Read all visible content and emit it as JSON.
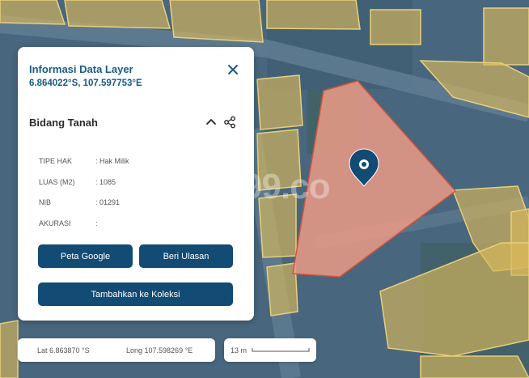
{
  "panel": {
    "title": "Informasi Data Layer",
    "coordinates": "6.864022°S, 107.597753°E",
    "section_title": "Bidang Tanah",
    "fields": [
      {
        "label": "TIPE HAK",
        "value": ": Hak Milik"
      },
      {
        "label": "LUAS (M2)",
        "value": ": 1085"
      },
      {
        "label": "NIB",
        "value": ": 01291"
      },
      {
        "label": "AKURASI",
        "value": ":"
      }
    ],
    "buttons": {
      "google": "Peta Google",
      "review": "Beri Ulasan",
      "collection": "Tambahkan ke Koleksi"
    }
  },
  "footer": {
    "lat": "Lat 6.863870 °S",
    "long": "Long 107.598269 °E",
    "scale": "13 m"
  },
  "map": {
    "watermark": "99.co",
    "colors": {
      "parcel": "#d9b85a",
      "selected": "#ec9b85",
      "selected_border": "#d6533d",
      "brand": "#124b74"
    },
    "icons": [
      "location-pin-icon",
      "close-icon",
      "chevron-up-icon",
      "share-icon"
    ]
  }
}
